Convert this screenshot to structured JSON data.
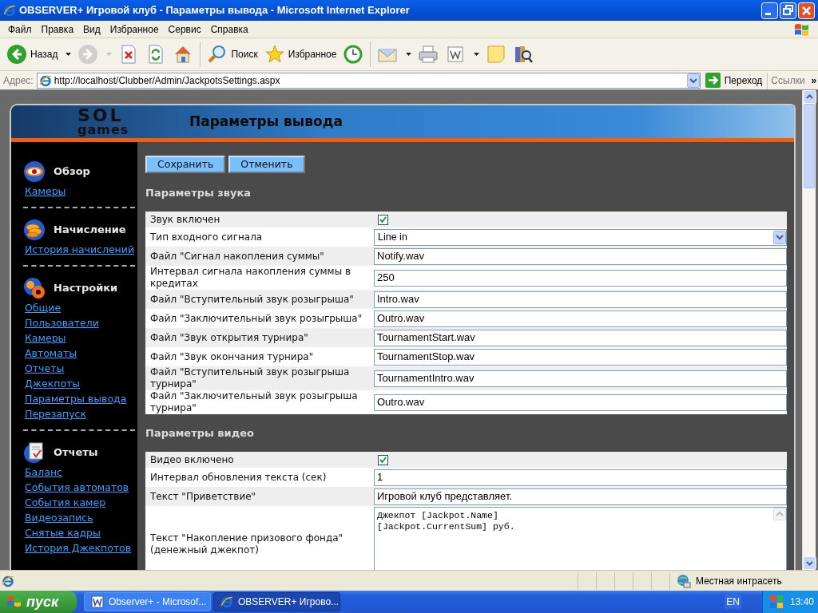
{
  "window": {
    "title": "OBSERVER+ Игровой клуб - Параметры вывода - Microsoft Internet Explorer"
  },
  "menu": [
    "Файл",
    "Правка",
    "Вид",
    "Избранное",
    "Сервис",
    "Справка"
  ],
  "toolbar": [
    {
      "kind": "back",
      "label": "Назад",
      "dropdown": true,
      "disabled": false
    },
    {
      "kind": "forward",
      "dropdown": true,
      "disabled": true
    },
    {
      "kind": "stop",
      "dropdown": false,
      "disabled": false
    },
    {
      "kind": "refresh",
      "dropdown": false,
      "disabled": false
    },
    {
      "kind": "home",
      "dropdown": false,
      "disabled": false
    },
    {
      "kind": "separator"
    },
    {
      "kind": "search",
      "label": "Поиск",
      "dropdown": false,
      "disabled": false
    },
    {
      "kind": "favorites",
      "label": "Избранное",
      "dropdown": false,
      "disabled": false
    },
    {
      "kind": "history",
      "dropdown": false,
      "disabled": false
    },
    {
      "kind": "separator"
    },
    {
      "kind": "mail",
      "dropdown": true,
      "disabled": false
    },
    {
      "kind": "print",
      "dropdown": false,
      "disabled": false
    },
    {
      "kind": "word",
      "dropdown": true,
      "disabled": false
    },
    {
      "kind": "note",
      "dropdown": false,
      "disabled": false
    },
    {
      "kind": "research",
      "dropdown": false,
      "disabled": false
    }
  ],
  "address_bar": {
    "label": "Адрес:",
    "url": "http://localhost/Clubber/Admin/JackpotsSettings.aspx",
    "go": "Переход",
    "links": "Ссылки",
    "more": "»"
  },
  "page": {
    "logo_top": "SOL",
    "logo_bottom": "games",
    "title": "Параметры вывода",
    "sidebar": [
      {
        "kind": "eye",
        "title": "Обзор",
        "links": [
          "Камеры"
        ]
      },
      {
        "kind": "coins",
        "title": "Начисление",
        "links": [
          "История начислений"
        ]
      },
      {
        "kind": "gears",
        "title": "Настройки",
        "links": [
          "Общие",
          "Пользователи",
          "Камеры",
          "Автоматы",
          "Отчеты",
          "Джекпоты",
          "Параметры вывода",
          "Перезапуск"
        ]
      },
      {
        "kind": "report",
        "title": "Отчеты",
        "links": [
          "Баланс",
          "События автоматов",
          "События камер",
          "Видеозапись",
          "Снятые кадры",
          "История Джекпотов"
        ]
      }
    ],
    "buttons": [
      "Сохранить",
      "Отменить"
    ],
    "sections": [
      {
        "title": "Параметры звука",
        "rows": [
          {
            "label": "Звук включен",
            "kind": "checkbox",
            "checked": true
          },
          {
            "label": "Тип входного сигнала",
            "kind": "select",
            "value": "Line in"
          },
          {
            "label": "Файл \"Сигнал накопления суммы\"",
            "kind": "text",
            "value": "Notify.wav"
          },
          {
            "label": "Интервал сигнала накопления суммы в кредитах",
            "kind": "text",
            "value": "250"
          },
          {
            "label": "Файл \"Вступительный звук розыгрыша\"",
            "kind": "text",
            "value": "Intro.wav"
          },
          {
            "label": "Файл \"Заключительный звук розыгрыша\"",
            "kind": "text",
            "value": "Outro.wav"
          },
          {
            "label": "Файл \"Звук открытия турнира\"",
            "kind": "text",
            "value": "TournamentStart.wav"
          },
          {
            "label": "Файл \"Звук окончания турнира\"",
            "kind": "text",
            "value": "TournamentStop.wav"
          },
          {
            "label": "Файл \"Вступительный звук розыгрыша турнира\"",
            "kind": "text",
            "value": "TournamentIntro.wav"
          },
          {
            "label": "Файл \"Заключительный звук розыгрыша турнира\"",
            "kind": "text",
            "value": "Outro.wav"
          }
        ]
      },
      {
        "title": "Параметры видео",
        "rows": [
          {
            "label": "Видео включено",
            "kind": "checkbox",
            "checked": true
          },
          {
            "label": "Интервал обновления текста (сек)",
            "kind": "text",
            "value": "1"
          },
          {
            "label": "Текст \"Приветствие\"",
            "kind": "text",
            "value": "Игровой клуб представляет."
          },
          {
            "label": "Текст \"Накопление призового фонда\" (денежный джекпот)",
            "kind": "textarea",
            "lines": [
              "Джекпот [Jackpot.Name]",
              "[Jackpot.CurrentSum] руб."
            ]
          }
        ]
      }
    ]
  },
  "status_bar": {
    "zone": "Местная интрасеть"
  },
  "taskbar": {
    "start": "пуск",
    "tasks": [
      {
        "kind": "word",
        "label": "Observer+ - Microsof...",
        "selected": false
      },
      {
        "kind": "ie",
        "label": "OBSERVER+ Игрово...",
        "selected": true
      }
    ],
    "language": "EN",
    "clock": "13:40"
  }
}
